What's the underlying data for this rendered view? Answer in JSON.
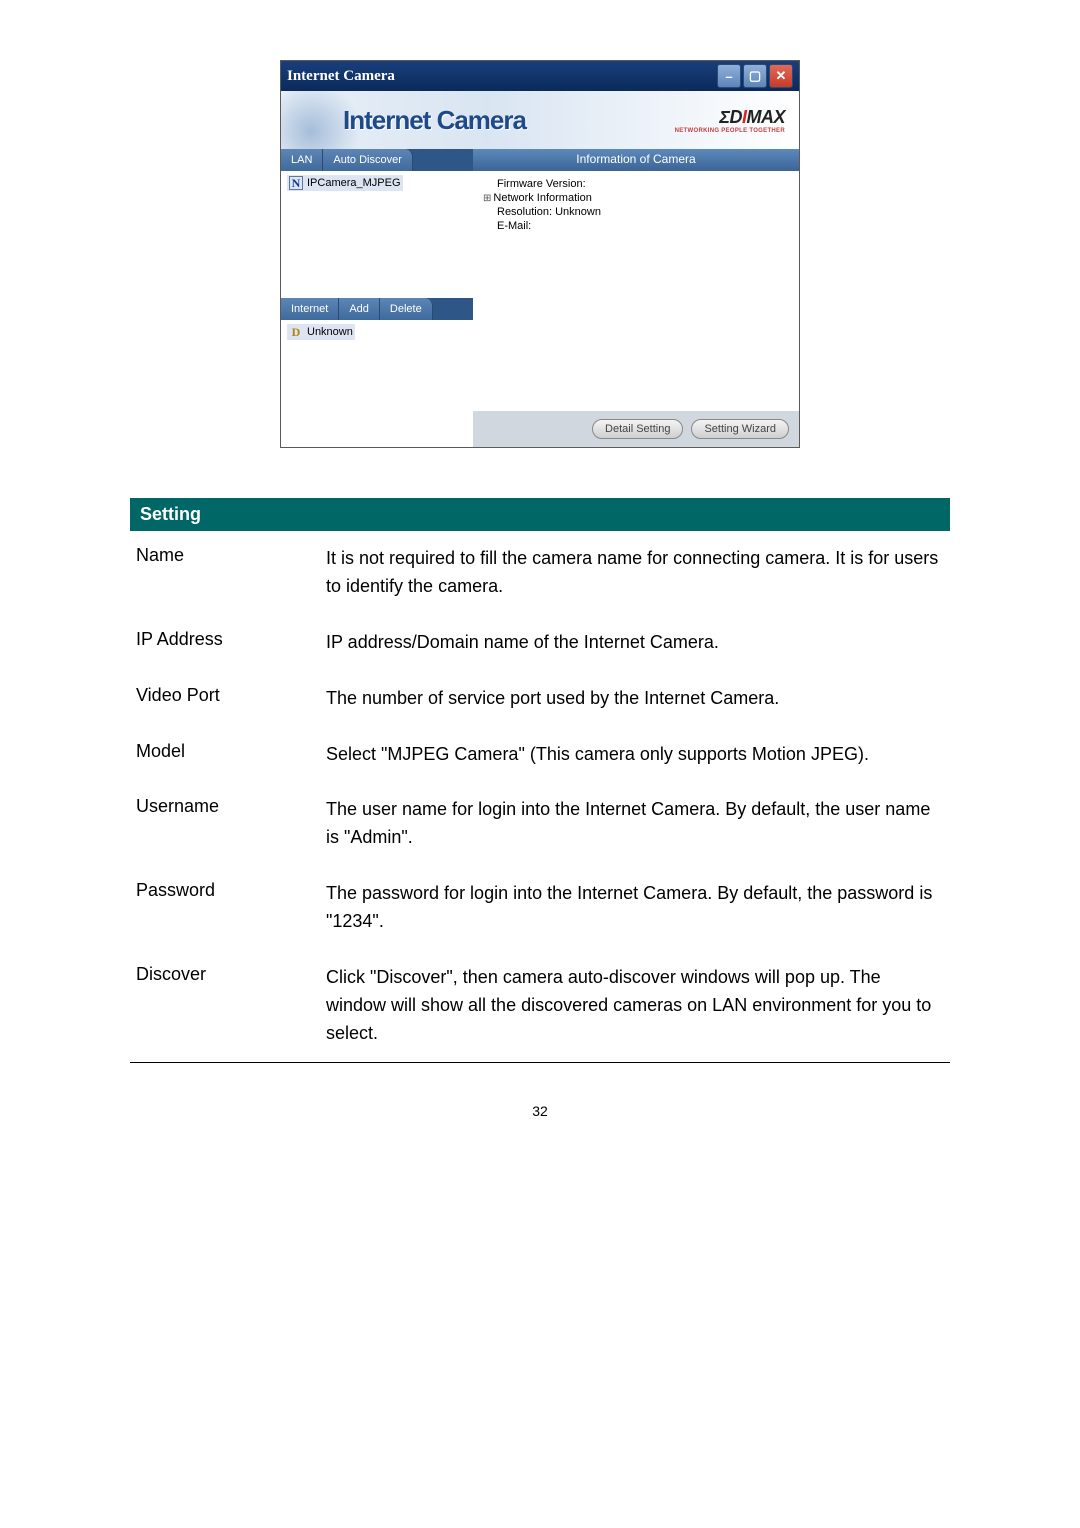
{
  "window": {
    "title": "Internet Camera",
    "banner_title": "Internet Camera",
    "brand_name_prefix": "ΣD",
    "brand_name_mid": "I",
    "brand_name_suffix": "MAX",
    "brand_tagline": "NETWORKING PEOPLE TOGETHER",
    "min_glyph": "–",
    "max_glyph": "▢",
    "close_glyph": "✕",
    "left_top_tabs": [
      "LAN",
      "Auto Discover"
    ],
    "lan_item_badge": "N",
    "lan_item_label": "IPCamera_MJPEG",
    "left_mid_tabs": [
      "Internet",
      "Add",
      "Delete"
    ],
    "internet_item_badge": "D",
    "internet_item_label": "Unknown",
    "right_header": "Information of Camera",
    "tree": {
      "firmware": "Firmware Version:",
      "network": "Network Information",
      "resolution": "Resolution: Unknown",
      "email": "E-Mail:"
    },
    "btn_detail": "Detail Setting",
    "btn_wizard": "Setting Wizard"
  },
  "table": {
    "header": "Setting",
    "rows": [
      {
        "label": "Name",
        "desc": "It is not required to fill the camera name for connecting camera. It is for users to identify the camera."
      },
      {
        "label": "IP Address",
        "desc": "IP address/Domain name of the Internet Camera."
      },
      {
        "label": "Video Port",
        "desc": "The number of service port used by the Internet Camera."
      },
      {
        "label": "Model",
        "desc": "Select \"MJPEG Camera\" (This camera only supports Motion JPEG)."
      },
      {
        "label": "Username",
        "desc": "The user name for login into the Internet Camera. By default, the user name is \"Admin\"."
      },
      {
        "label": "Password",
        "desc": "The password for login into the Internet Camera. By default, the password is \"1234\"."
      },
      {
        "label": "Discover",
        "desc": "Click \"Discover\", then camera auto-discover windows will pop up. The window will show all the discovered cameras on LAN environment for you to select."
      }
    ]
  },
  "page_number": "32"
}
